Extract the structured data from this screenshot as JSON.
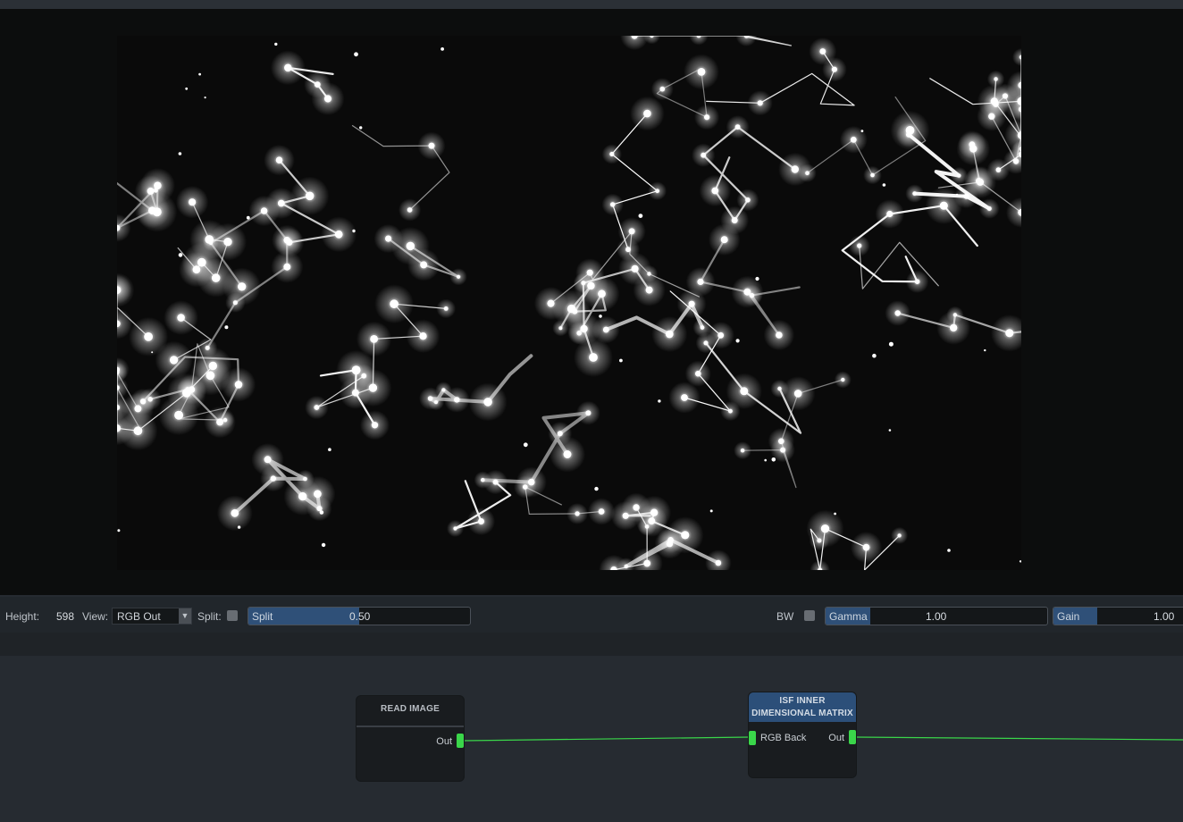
{
  "viewer": {
    "height_label": "Height:",
    "height_value": "598",
    "view_label": "View:",
    "view_selected": "RGB Out",
    "split_label": "Split:",
    "split_checked": false,
    "split_slider": {
      "label": "Split",
      "value": "0.50",
      "fraction": 0.5
    },
    "bw_label": "BW",
    "bw_checked": false,
    "gamma_slider": {
      "label": "Gamma",
      "value": "1.00",
      "fraction": 0.2
    },
    "gain_slider": {
      "label": "Gain",
      "value": "1.00",
      "fraction": 0.34
    }
  },
  "nodes": [
    {
      "title": "READ IMAGE",
      "outputs": [
        "Out"
      ],
      "header_color": "#191c1f"
    },
    {
      "title": "ISF INNER DIMENSIONAL MATRIX",
      "inputs": [
        "RGB Back"
      ],
      "outputs": [
        "Out"
      ],
      "header_color": "#2c4f79"
    }
  ],
  "colors": {
    "wire": "#3ad64a",
    "port": "#3ad64a",
    "slider_fill": "#2f5078",
    "panel": "#262b31"
  }
}
